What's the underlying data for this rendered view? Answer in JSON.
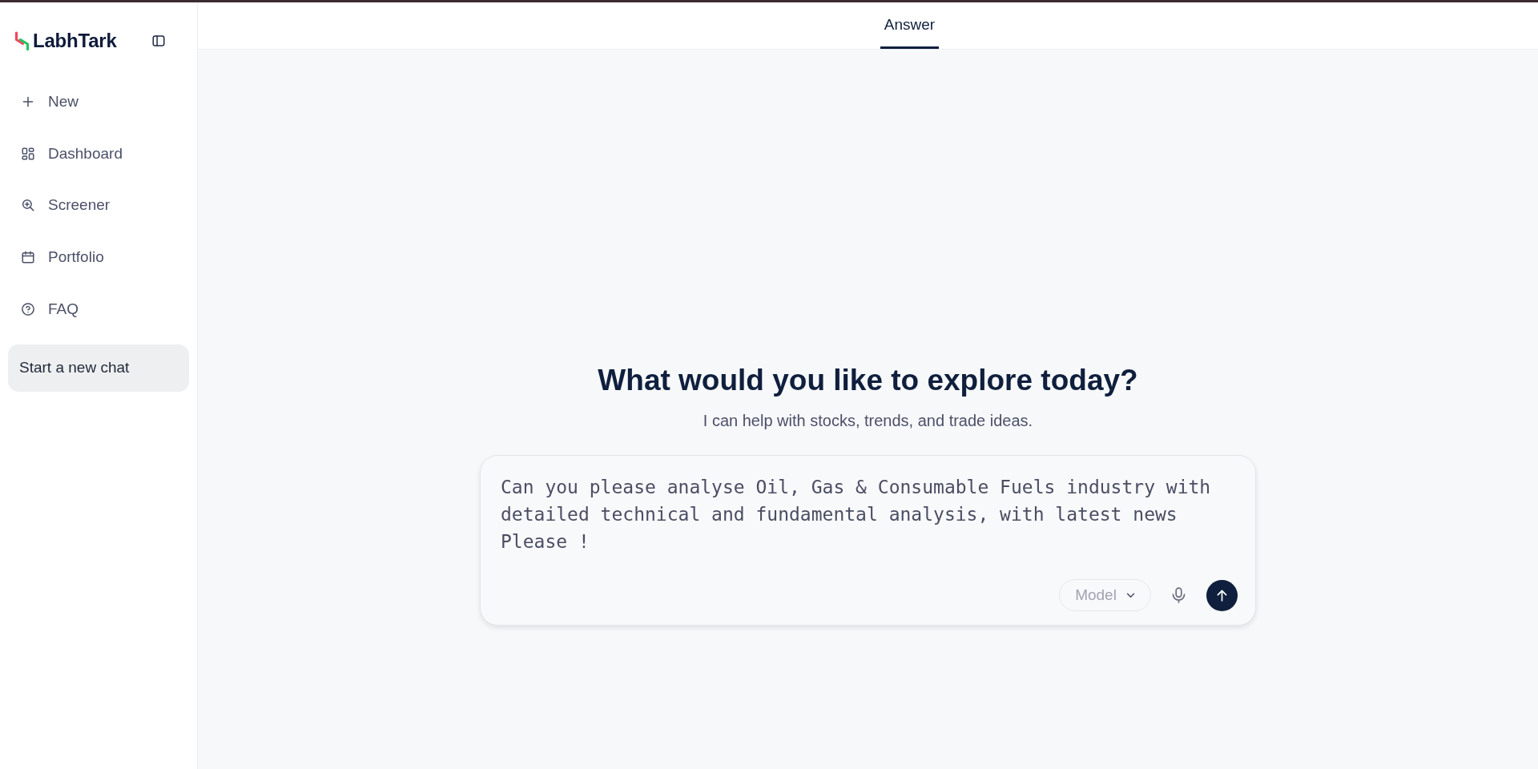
{
  "sidebar": {
    "brand": "LabhTark",
    "nav_items": [
      {
        "label": "New"
      },
      {
        "label": "Dashboard"
      },
      {
        "label": "Screener"
      },
      {
        "label": "Portfolio"
      },
      {
        "label": "FAQ"
      }
    ],
    "chats": [
      {
        "label": "Start a new chat",
        "selected": true
      }
    ]
  },
  "header": {
    "tabs": [
      {
        "label": "Answer",
        "selected": true
      }
    ]
  },
  "main": {
    "heading": "What would you like to explore today?",
    "subheading": "I can help with stocks, trends, and trade ideas.",
    "composer": {
      "value": "Can you please analyse Oil, Gas & Consumable Fuels industry with detailed technical and fundamental analysis, with latest news Please !",
      "model_button": {
        "label": "Model"
      }
    }
  }
}
